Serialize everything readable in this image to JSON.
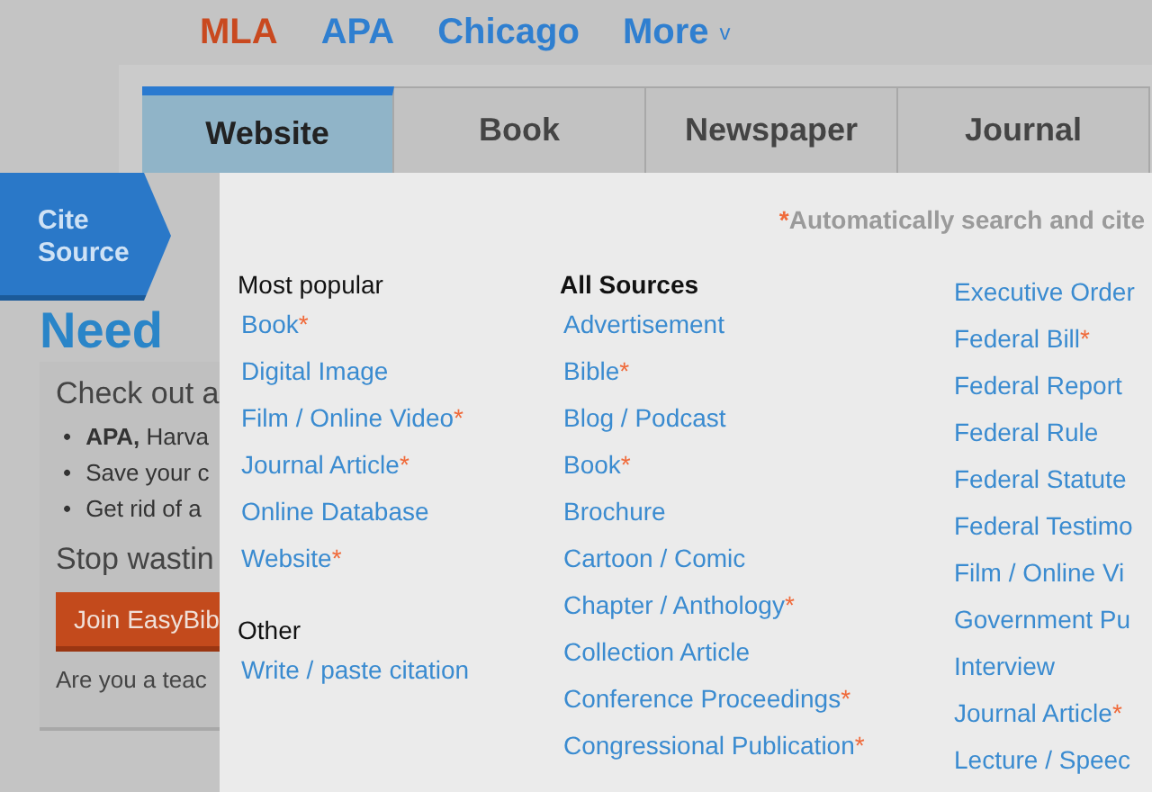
{
  "styles": [
    {
      "label": "MLA",
      "selected": true
    },
    {
      "label": "APA",
      "selected": false
    },
    {
      "label": "Chicago",
      "selected": false
    },
    {
      "label": "More",
      "selected": false,
      "caret": "v"
    }
  ],
  "tabs": [
    {
      "label": "Website",
      "selected": true
    },
    {
      "label": "Book",
      "selected": false
    },
    {
      "label": "Newspaper",
      "selected": false
    },
    {
      "label": "Journal",
      "selected": false
    }
  ],
  "ribbon": [
    "Cite",
    "Source"
  ],
  "background": {
    "heading": "Need",
    "intro": "Check out a",
    "marker": "•",
    "bullets": [
      "**APA,** Harva",
      "Save your c",
      "Get rid of a"
    ],
    "tagline": "Stop wastin",
    "button": "Join EasyBib",
    "footer": "Are you a teac"
  },
  "note": {
    "mark": "*",
    "text": "Automatically search and cite"
  },
  "columns": [
    {
      "heading": "Most popular",
      "heading_bold": false,
      "groups": [
        {
          "items": [
            {
              "label": "Book",
              "starred": true
            },
            {
              "label": "Digital Image",
              "starred": false
            },
            {
              "label": "Film / Online Video",
              "starred": true
            },
            {
              "label": "Journal Article",
              "starred": true
            },
            {
              "label": "Online Database",
              "starred": false
            },
            {
              "label": "Website",
              "starred": true
            }
          ]
        },
        {
          "heading": "Other",
          "items": [
            {
              "label": "Write / paste citation",
              "starred": false
            }
          ]
        }
      ]
    },
    {
      "heading": "All Sources",
      "heading_bold": true,
      "groups": [
        {
          "items": [
            {
              "label": "Advertisement",
              "starred": false
            },
            {
              "label": "Bible",
              "starred": true
            },
            {
              "label": "Blog / Podcast",
              "starred": false
            },
            {
              "label": "Book",
              "starred": true
            },
            {
              "label": "Brochure",
              "starred": false
            },
            {
              "label": "Cartoon / Comic",
              "starred": false
            },
            {
              "label": "Chapter / Anthology",
              "starred": true
            },
            {
              "label": "Collection Article",
              "starred": false
            },
            {
              "label": "Conference Proceedings",
              "starred": true
            },
            {
              "label": "Congressional Publication",
              "starred": true
            }
          ]
        }
      ]
    },
    {
      "groups": [
        {
          "items": [
            {
              "label": "Executive Order",
              "starred": false
            },
            {
              "label": "Federal Bill",
              "starred": true
            },
            {
              "label": "Federal Report",
              "starred": false
            },
            {
              "label": "Federal Rule",
              "starred": false
            },
            {
              "label": "Federal Statute",
              "starred": false
            },
            {
              "label": "Federal Testimo",
              "starred": false
            },
            {
              "label": "Film / Online Vi",
              "starred": false
            },
            {
              "label": "Government Pu",
              "starred": false
            },
            {
              "label": "Interview",
              "starred": false
            },
            {
              "label": "Journal Article",
              "starred": true
            },
            {
              "label": "Lecture / Speec",
              "starred": false
            }
          ]
        }
      ]
    }
  ]
}
